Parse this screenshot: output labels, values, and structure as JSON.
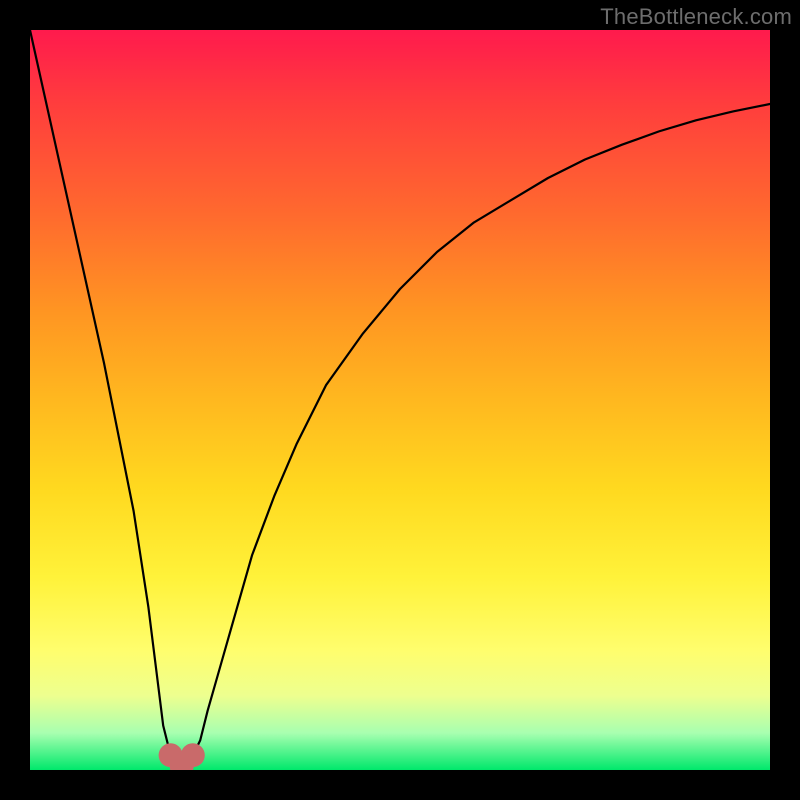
{
  "watermark": "TheBottleneck.com",
  "chart_data": {
    "type": "line",
    "title": "",
    "xlabel": "",
    "ylabel": "",
    "xlim": [
      0,
      100
    ],
    "ylim": [
      0,
      100
    ],
    "grid": false,
    "background": "red-yellow-green vertical gradient",
    "series": [
      {
        "name": "bottleneck-curve",
        "color": "#000000",
        "x": [
          0,
          2,
          4,
          6,
          8,
          10,
          12,
          14,
          16,
          17,
          18,
          19,
          20,
          21,
          22,
          23,
          24,
          26,
          28,
          30,
          33,
          36,
          40,
          45,
          50,
          55,
          60,
          65,
          70,
          75,
          80,
          85,
          90,
          95,
          100
        ],
        "y": [
          100,
          91,
          82,
          73,
          64,
          55,
          45,
          35,
          22,
          14,
          6,
          2,
          1,
          1,
          2,
          4,
          8,
          15,
          22,
          29,
          37,
          44,
          52,
          59,
          65,
          70,
          74,
          77,
          80,
          82.5,
          84.5,
          86.3,
          87.8,
          89,
          90
        ]
      }
    ],
    "markers": [
      {
        "name": "min-marker-left",
        "x": 19,
        "y": 2,
        "color": "#c96a6a",
        "size": 12
      },
      {
        "name": "min-marker-right",
        "x": 22,
        "y": 2,
        "color": "#c96a6a",
        "size": 12
      },
      {
        "name": "min-marker-bottom",
        "x": 20.5,
        "y": 0.5,
        "color": "#c96a6a",
        "size": 12
      }
    ]
  }
}
